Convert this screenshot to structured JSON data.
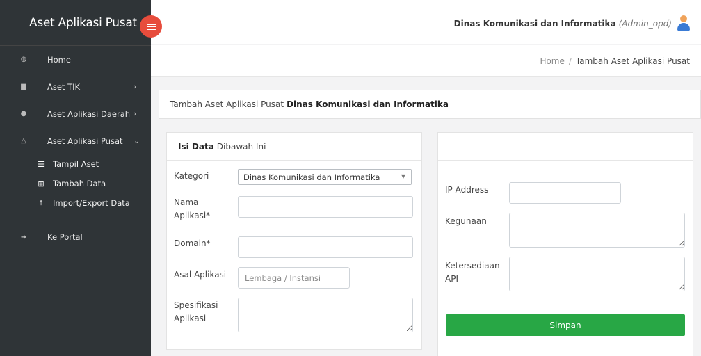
{
  "app": {
    "title": "Aset Aplikasi Pusat"
  },
  "sidebar": {
    "items": [
      {
        "label": "Home",
        "icon": "dashboard-icon"
      },
      {
        "label": "Aset TIK",
        "icon": "briefcase-icon",
        "chevron": "›"
      },
      {
        "label": "Aset Aplikasi Daerah",
        "icon": "android-icon",
        "chevron": "›"
      },
      {
        "label": "Aset Aplikasi Pusat",
        "icon": "flask-icon",
        "chevron": "⌄"
      }
    ],
    "subitems": [
      {
        "label": "Tampil Aset",
        "icon": "list-icon"
      },
      {
        "label": "Tambah Data",
        "icon": "plus-square-icon"
      },
      {
        "label": "Import/Export Data",
        "icon": "upload-icon"
      }
    ],
    "portal": {
      "label": "Ke Portal",
      "icon": "sign-in-icon"
    }
  },
  "header": {
    "user_name": "Dinas Komunikasi dan Informatika",
    "user_role": "(Admin_opd)"
  },
  "breadcrumb": {
    "home": "Home",
    "separator": "/",
    "current": "Tambah Aset Aplikasi Pusat"
  },
  "page": {
    "title_prefix": "Tambah Aset Aplikasi Pusat",
    "title_org": "Dinas Komunikasi dan Informatika"
  },
  "form_left": {
    "heading_bold": "Isi Data",
    "heading_rest": "Dibawah Ini",
    "kategori_label": "Kategori",
    "kategori_value": "Dinas Komunikasi dan Informatika",
    "nama_label_1": "Nama",
    "nama_label_2": "Aplikasi*",
    "domain_label": "Domain*",
    "asal_label": "Asal Aplikasi",
    "asal_placeholder": "Lembaga / Instansi",
    "spesifikasi_label_1": "Spesifikasi",
    "spesifikasi_label_2": "Aplikasi"
  },
  "form_right": {
    "ip_label": "IP Address",
    "kegunaan_label": "Kegunaan",
    "api_label_1": "Ketersediaan",
    "api_label_2": "API",
    "submit_label": "Simpan"
  },
  "colors": {
    "sidebar_bg": "#2f3437",
    "toggle": "#e74c3c",
    "save_button": "#28a745"
  }
}
